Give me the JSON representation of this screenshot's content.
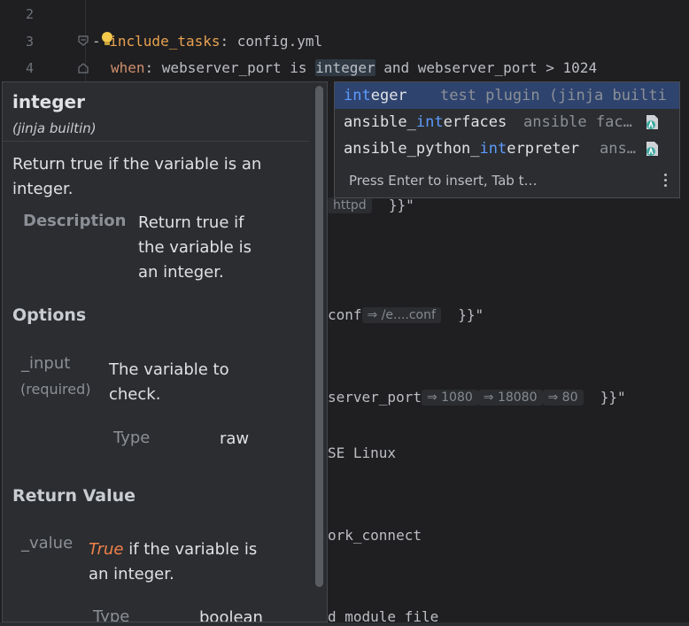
{
  "editor": {
    "line_numbers": [
      "2",
      "3",
      "4"
    ],
    "line3": {
      "dash": "- ",
      "key": "include_tasks",
      "colon": ": ",
      "value": "config.yml"
    },
    "line4": {
      "key": "when",
      "colon": ": ",
      "pre": "webserver_port is ",
      "word": "integer",
      "post": " and webserver_port > 1024"
    },
    "fragments": {
      "f1_hint": "httpd",
      "f1_tail": "}}\"",
      "f2_text": "conf",
      "f2_hint": "⇒ /e....conf",
      "f2_tail": "}}\"",
      "f3_text": "server_port",
      "f3_hint1": "⇒ 1080",
      "f3_hint2": "⇒ 18080",
      "f3_hint3": "⇒ 80",
      "f3_tail": "}}\"",
      "f4_text": "SE Linux",
      "f5_text": "ork_connect",
      "f6_text": "d module file"
    }
  },
  "completion": {
    "items": [
      {
        "match": "int",
        "rest": "eger",
        "type": "test plugin (jinja builti",
        "selected": true
      },
      {
        "pre": "ansible_",
        "match": "int",
        "rest": "erfaces",
        "type": "ansible fac…",
        "icon": "ansible-icon"
      },
      {
        "pre": "ansible_python_",
        "match": "int",
        "rest": "erpreter",
        "type": "ans…",
        "icon": "ansible-icon"
      }
    ],
    "footer": "Press Enter to insert, Tab t…"
  },
  "doc": {
    "title": "integer",
    "subtitle": "(jinja builtin)",
    "summary_1": "Return true if the variable is an",
    "summary_2": "integer.",
    "description_label": "Description",
    "description_1": "Return true if",
    "description_2": "the variable is",
    "description_3": "an integer.",
    "options_heading": "Options",
    "option_name": "_input",
    "option_required": "(required)",
    "option_desc_1": "The variable to",
    "option_desc_2": "check.",
    "type_label": "Type",
    "type_value": "raw",
    "return_heading": "Return Value",
    "return_name": "_value",
    "return_true": "True",
    "return_desc_1": " if the variable is",
    "return_desc_2": "an integer.",
    "return_type_label": "Type",
    "return_type_value": "boolean"
  },
  "colors": {
    "editor_bg": "#1f1f21",
    "popup_bg": "#2b2d30",
    "selection": "#2e436e",
    "match": "#5e9bff",
    "yaml_key": "#e8a24f",
    "true_literal": "#f0804a"
  }
}
